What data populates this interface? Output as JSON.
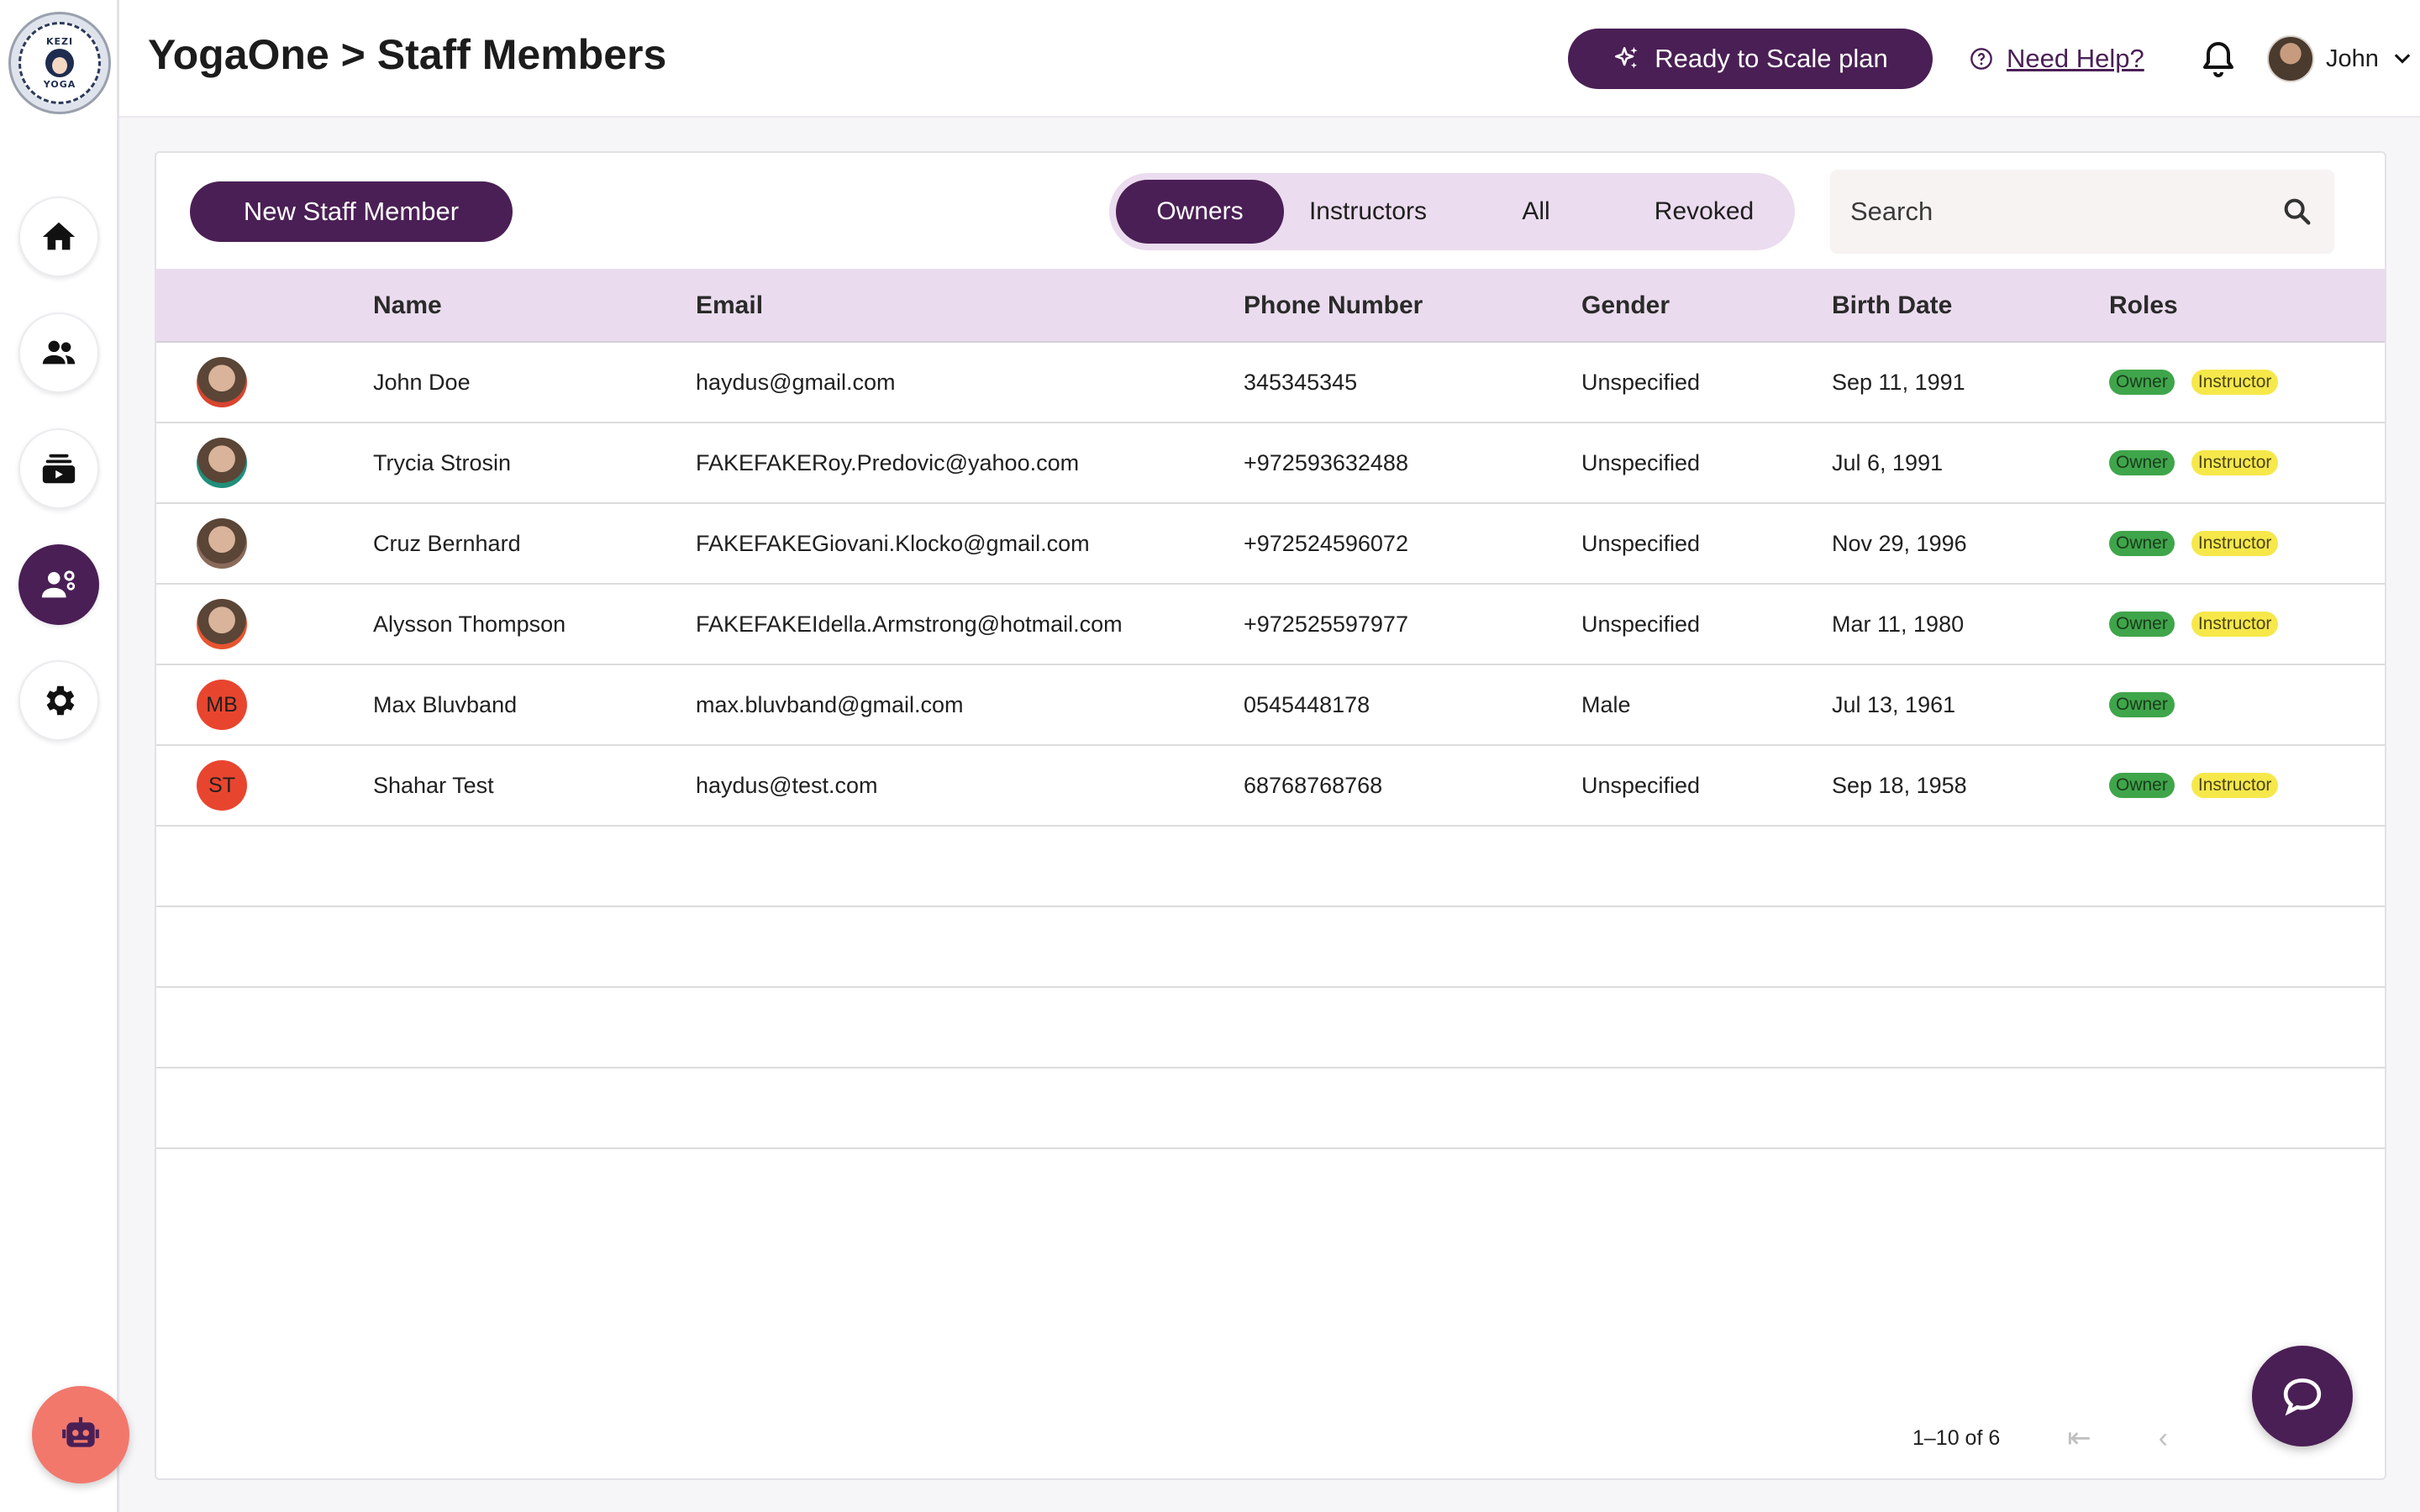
{
  "header": {
    "title": "YogaOne > Staff Members",
    "upgrade_label": "Ready to Scale plan",
    "help_label": "Need Help?",
    "user_name": "John"
  },
  "logo": {
    "text_top": "KEZI",
    "text_bottom": "YOGA"
  },
  "sidebar": {
    "items": [
      {
        "icon": "home-icon",
        "active": false
      },
      {
        "icon": "people-icon",
        "active": false
      },
      {
        "icon": "classes-icon",
        "active": false
      },
      {
        "icon": "staff-icon",
        "active": true
      },
      {
        "icon": "gear-icon",
        "active": false
      }
    ],
    "assistant_icon": "robot-icon"
  },
  "toolbar": {
    "new_label": "New Staff Member",
    "tabs": [
      "Owners",
      "Instructors",
      "All",
      "Revoked"
    ],
    "active_tab": "Owners",
    "search_placeholder": "Search"
  },
  "table": {
    "columns": [
      "Name",
      "Email",
      "Phone Number",
      "Gender",
      "Birth Date",
      "Roles"
    ],
    "rows": [
      {
        "avatar": "photo",
        "avatar_color": "#d8452f",
        "initials": "",
        "name": "John Doe",
        "email": "haydus@gmail.com",
        "phone": "345345345",
        "gender": "Unspecified",
        "birth": "Sep 11, 1991",
        "roles": [
          "Owner",
          "Instructor"
        ]
      },
      {
        "avatar": "photo",
        "avatar_color": "#1f8f7a",
        "initials": "",
        "name": "Trycia Strosin",
        "email": "FAKEFAKERoy.Predovic@yahoo.com",
        "phone": "+972593632488",
        "gender": "Unspecified",
        "birth": "Jul 6, 1991",
        "roles": [
          "Owner",
          "Instructor"
        ]
      },
      {
        "avatar": "photo",
        "avatar_color": "#8a6a5a",
        "initials": "",
        "name": "Cruz Bernhard",
        "email": "FAKEFAKEGiovani.Klocko@gmail.com",
        "phone": "+972524596072",
        "gender": "Unspecified",
        "birth": "Nov 29, 1996",
        "roles": [
          "Owner",
          "Instructor"
        ]
      },
      {
        "avatar": "photo",
        "avatar_color": "#e8542f",
        "initials": "",
        "name": "Alysson Thompson",
        "email": "FAKEFAKEIdella.Armstrong@hotmail.com",
        "phone": "+972525597977",
        "gender": "Unspecified",
        "birth": "Mar 11, 1980",
        "roles": [
          "Owner",
          "Instructor"
        ]
      },
      {
        "avatar": "initials",
        "avatar_color": "#e8452f",
        "initials": "MB",
        "name": "Max Bluvband",
        "email": "max.bluvband@gmail.com",
        "phone": "0545448178",
        "gender": "Male",
        "birth": "Jul 13, 1961",
        "roles": [
          "Owner"
        ]
      },
      {
        "avatar": "initials",
        "avatar_color": "#e8452f",
        "initials": "ST",
        "name": "Shahar Test",
        "email": "haydus@test.com",
        "phone": "68768768768",
        "gender": "Unspecified",
        "birth": "Sep 18, 1958",
        "roles": [
          "Owner",
          "Instructor"
        ]
      }
    ],
    "empty_rows": 4
  },
  "pagination": {
    "label": "1–10 of 6"
  },
  "colors": {
    "primary": "#4a1f55",
    "header_bg": "#eadcee",
    "owner": "#3fa54a",
    "instructor": "#f6e84a",
    "assistant": "#f2786c"
  }
}
